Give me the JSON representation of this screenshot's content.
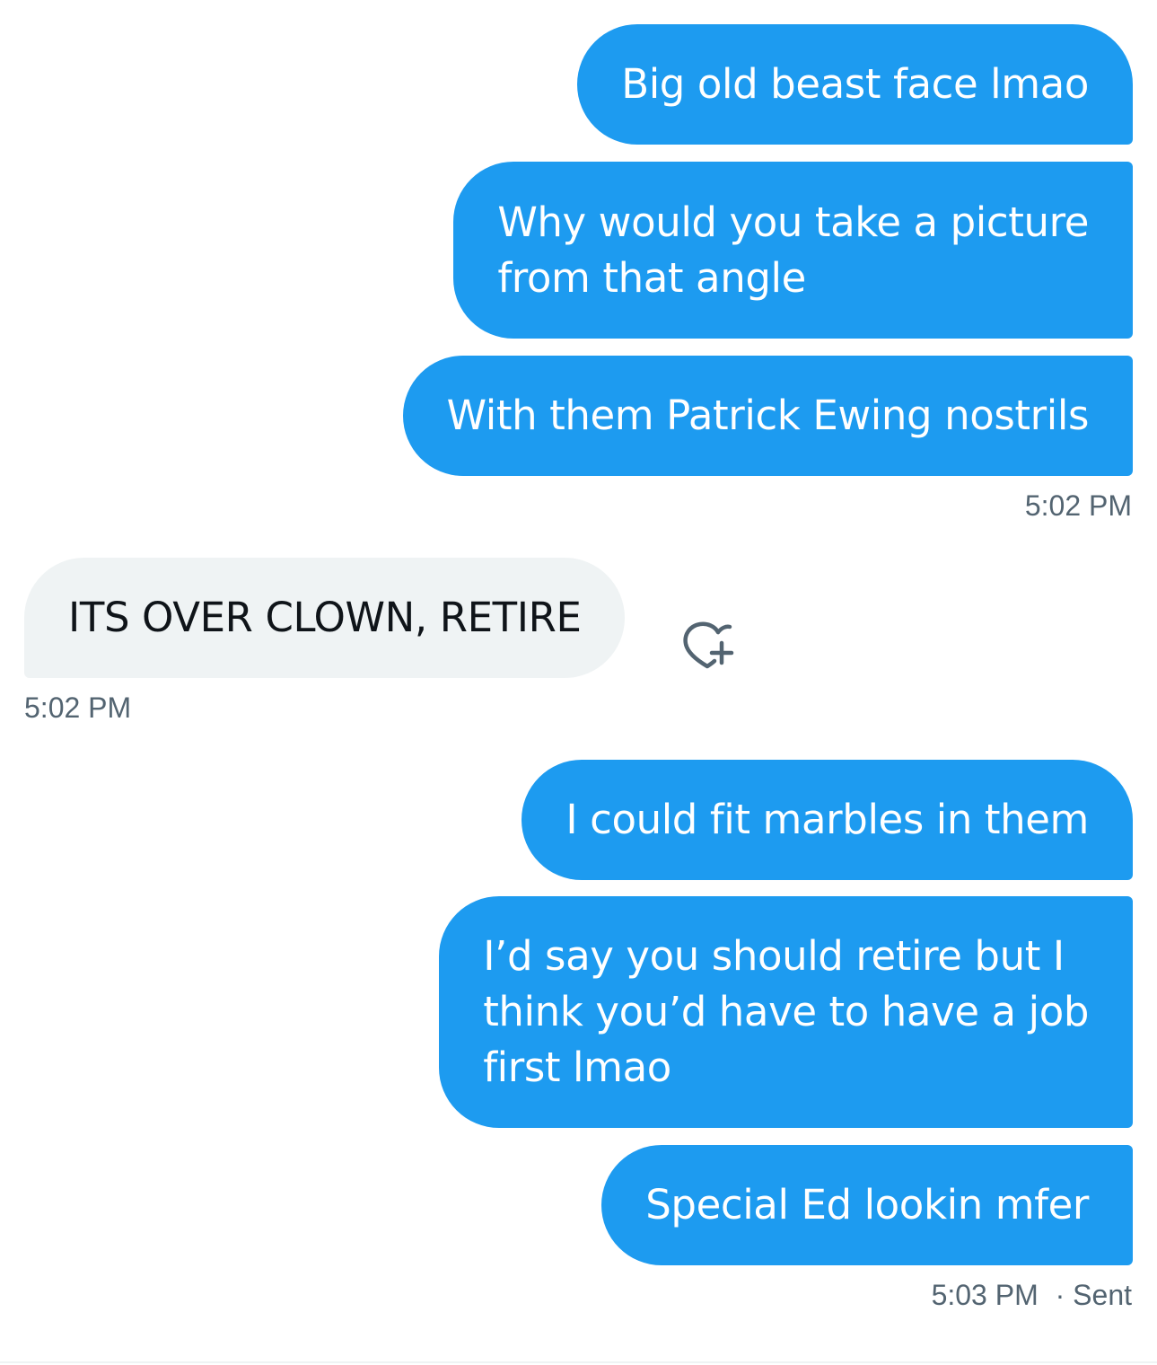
{
  "messages": [
    {
      "id": "m1",
      "side": "sent",
      "lines": [
        "Big old beast face lmao"
      ]
    },
    {
      "id": "m2",
      "side": "sent",
      "lines": [
        "Why would you take a picture",
        "from that angle"
      ]
    },
    {
      "id": "m3",
      "side": "sent",
      "lines": [
        "With them Patrick Ewing nostrils"
      ]
    },
    {
      "id": "m4",
      "side": "received",
      "lines": [
        "ITS OVER CLOWN, RETIRE"
      ]
    },
    {
      "id": "m5",
      "side": "sent",
      "lines": [
        "I could fit marbles in them"
      ]
    },
    {
      "id": "m6",
      "side": "sent",
      "lines": [
        "I’d say you should retire but I",
        "think you’d have to have a job",
        "first lmao"
      ]
    },
    {
      "id": "m7",
      "side": "sent",
      "lines": [
        "Special Ed lookin mfer"
      ]
    }
  ],
  "timestamps": {
    "group1": "5:02 PM",
    "received": "5:02 PM",
    "group2": "5:03 PM",
    "group2_status": "· Sent"
  },
  "icons": {
    "react": "heart-plus-icon"
  },
  "colors": {
    "sent_bubble": "#1d9bf0",
    "received_bubble": "#eff3f4",
    "timestamp": "#536471"
  }
}
